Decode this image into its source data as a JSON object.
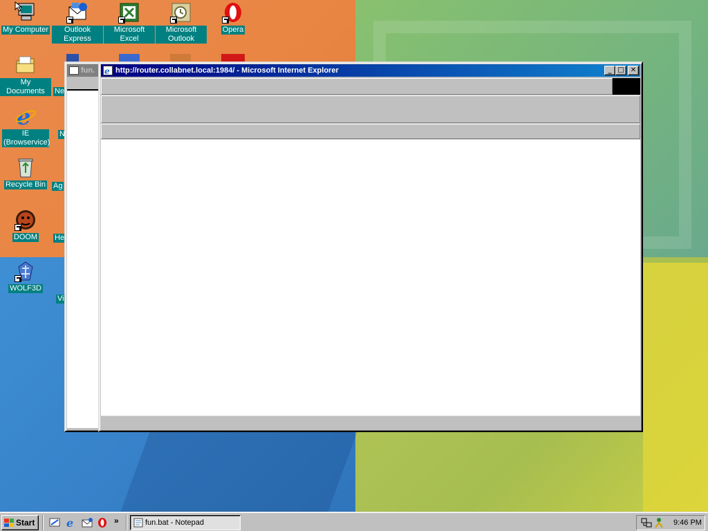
{
  "desktop": {
    "icons": [
      {
        "label": "My Computer"
      },
      {
        "label": "Outlook Express"
      },
      {
        "label": "Microsoft Excel"
      },
      {
        "label": "Microsoft Outlook"
      },
      {
        "label": "Opera"
      },
      {
        "label": "My Documents"
      },
      {
        "label": "IE (Browservice)"
      },
      {
        "label": "Recycle Bin"
      },
      {
        "label": "DOOM"
      },
      {
        "label": "WOLF3D"
      }
    ],
    "partial_labels": [
      "Ne",
      "N",
      "Ag",
      "He",
      "Vi"
    ]
  },
  "notepad_window": {
    "title": "fun."
  },
  "browser_window": {
    "title": "http://router.collabnet.local:1984/ - Microsoft Internet Explorer",
    "buttons": {
      "minimize": "_",
      "maximize": "□",
      "close": "✕"
    }
  },
  "taskbar": {
    "start_label": "Start",
    "quick_launch": [
      "show-desktop-icon",
      "internet-explorer-icon",
      "outlook-express-icon",
      "opera-icon"
    ],
    "chevron": "»",
    "task_button_label": "fun.bat - Notepad",
    "clock": "9:46 PM"
  }
}
